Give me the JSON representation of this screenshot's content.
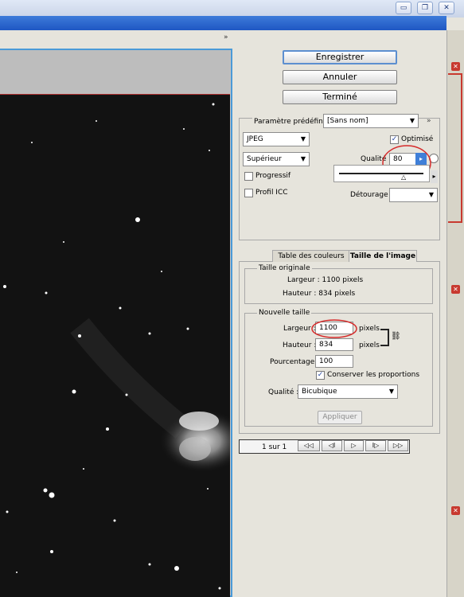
{
  "window": {
    "minimize_glyph": "▭",
    "restore_glyph": "❐",
    "close_glyph": "✕",
    "expand_glyph": "»"
  },
  "actions": {
    "save": "Enregistrer",
    "cancel": "Annuler",
    "done": "Terminé"
  },
  "settings": {
    "preset_label": "Paramètre prédéfini :",
    "preset_value": "[Sans nom]",
    "format_value": "JPEG",
    "quality_preset_value": "Supérieur",
    "optimized_label": "Optimisé",
    "optimized_checked": true,
    "quality_label": "Qualité :",
    "quality_value": "80",
    "progressive_label": "Progressif",
    "progressive_checked": false,
    "icc_label": "Profil ICC",
    "icc_checked": false,
    "matte_label": "Détourage :",
    "matte_value": ""
  },
  "tabs": {
    "color_table": "Table des couleurs",
    "image_size": "Taille de l'image",
    "active": "image_size"
  },
  "original_size": {
    "title": "Taille originale",
    "width_text": "Largeur : 1100 pixels",
    "height_text": "Hauteur : 834 pixels"
  },
  "new_size": {
    "title": "Nouvelle taille",
    "width_label": "Largeur :",
    "width_value": "1100",
    "width_unit": "pixels",
    "height_label": "Hauteur :",
    "height_value": "834",
    "height_unit": "pixels",
    "percent_label": "Pourcentage :",
    "percent_value": "100",
    "constrain_label": "Conserver les proportions",
    "constrain_checked": true,
    "quality_label": "Qualité :",
    "quality_value": "Bicubique",
    "apply_label": "Appliquer"
  },
  "pager": {
    "text": "1 sur 1",
    "first": "◁◁",
    "prev": "◁Ⅰ",
    "play": "▷",
    "next": "Ⅰ▷",
    "last": "▷▷"
  },
  "colors": {
    "accent_blue": "#4a9ad8",
    "highlight_red": "#d62a2a",
    "sky": "#121212"
  }
}
